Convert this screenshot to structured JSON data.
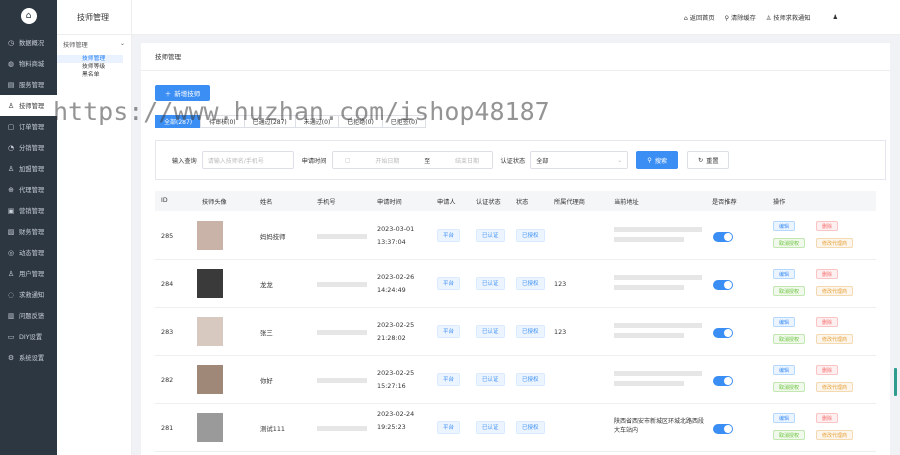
{
  "sidebar": {
    "items": [
      {
        "icon": "◷",
        "label": "数据概况"
      },
      {
        "icon": "◍",
        "label": "物料商城"
      },
      {
        "icon": "▤",
        "label": "服务管理"
      },
      {
        "icon": "♙",
        "label": "技师管理"
      },
      {
        "icon": "▢",
        "label": "订单管理"
      },
      {
        "icon": "◔",
        "label": "分销管理"
      },
      {
        "icon": "♙",
        "label": "加盟管理"
      },
      {
        "icon": "⊕",
        "label": "代理管理"
      },
      {
        "icon": "▣",
        "label": "营销管理"
      },
      {
        "icon": "▨",
        "label": "财务管理"
      },
      {
        "icon": "◎",
        "label": "动态管理"
      },
      {
        "icon": "♙",
        "label": "用户管理"
      },
      {
        "icon": "◌",
        "label": "求救通知"
      },
      {
        "icon": "▥",
        "label": "问题反馈"
      },
      {
        "icon": "▭",
        "label": "DIY设置"
      },
      {
        "icon": "⚙",
        "label": "系统设置"
      }
    ]
  },
  "submenu": {
    "title": "技师管理",
    "group": "技师管理",
    "items": [
      "技师管理",
      "技师等级",
      "黑名单"
    ]
  },
  "topbar": {
    "home": "返回首页",
    "cache": "清除缓存",
    "notify": "技师求救通知"
  },
  "panel": {
    "title": "技师管理",
    "add_button": "新增技师"
  },
  "tabs": [
    "全部(287)",
    "待审核(0)",
    "已通过(287)",
    "未通过(0)",
    "已拒绝(0)",
    "已拒签(0)"
  ],
  "filter": {
    "search_label": "输入查询",
    "search_placeholder": "请输入技师名/手机号",
    "date_label": "申请时间",
    "date_start": "开始日期",
    "date_sep": "至",
    "date_end": "结束日期",
    "status_label": "认证状态",
    "status_value": "全部",
    "search_btn": "搜索",
    "reset_btn": "重置"
  },
  "table": {
    "headers": [
      "ID",
      "技师头像",
      "姓名",
      "手机号",
      "申请时间",
      "申请人",
      "认证状态",
      "状态",
      "所属代理商",
      "当前地址",
      "是否推荐",
      "操作"
    ],
    "rows": [
      {
        "id": "285",
        "name": "妈妈技师",
        "date": "2023-03-01",
        "time": "13:37:04",
        "applicant": "平台",
        "auth": "已认证",
        "status": "已授权",
        "agent": "",
        "address": "",
        "a1": "编辑",
        "a2": "删除",
        "a3": "取消授权",
        "a4": "修改代理商",
        "thumb": "#c9b2a8"
      },
      {
        "id": "284",
        "name": "龙龙",
        "date": "2023-02-26",
        "time": "14:24:49",
        "applicant": "平台",
        "auth": "已认证",
        "status": "已授权",
        "agent": "123",
        "address": "",
        "a1": "编辑",
        "a2": "删除",
        "a3": "取消授权",
        "a4": "修改代理商",
        "thumb": "#3a3a3a"
      },
      {
        "id": "283",
        "name": "张三",
        "date": "2023-02-25",
        "time": "21:28:02",
        "applicant": "平台",
        "auth": "已认证",
        "status": "已授权",
        "agent": "123",
        "address": "",
        "a1": "编辑",
        "a2": "删除",
        "a3": "取消授权",
        "a4": "修改代理商",
        "thumb": "#d8c9c0"
      },
      {
        "id": "282",
        "name": "你好",
        "date": "2023-02-25",
        "time": "15:27:16",
        "applicant": "平台",
        "auth": "已认证",
        "status": "已授权",
        "agent": "",
        "address": "",
        "a1": "编辑",
        "a2": "删除",
        "a3": "取消授权",
        "a4": "修改代理商",
        "thumb": "#a08878"
      },
      {
        "id": "281",
        "name": "测试111",
        "date": "2023-02-24",
        "time": "19:25:23",
        "applicant": "平台",
        "auth": "已认证",
        "status": "已授权",
        "agent": "",
        "address": "陕西省西安市新城区环城北路西段大车站内",
        "a1": "编辑",
        "a2": "删除",
        "a3": "取消授权",
        "a4": "修改代理商",
        "thumb": "#9a9a9a"
      }
    ]
  },
  "watermark": "https://www.huzhan.com/ishop48187"
}
